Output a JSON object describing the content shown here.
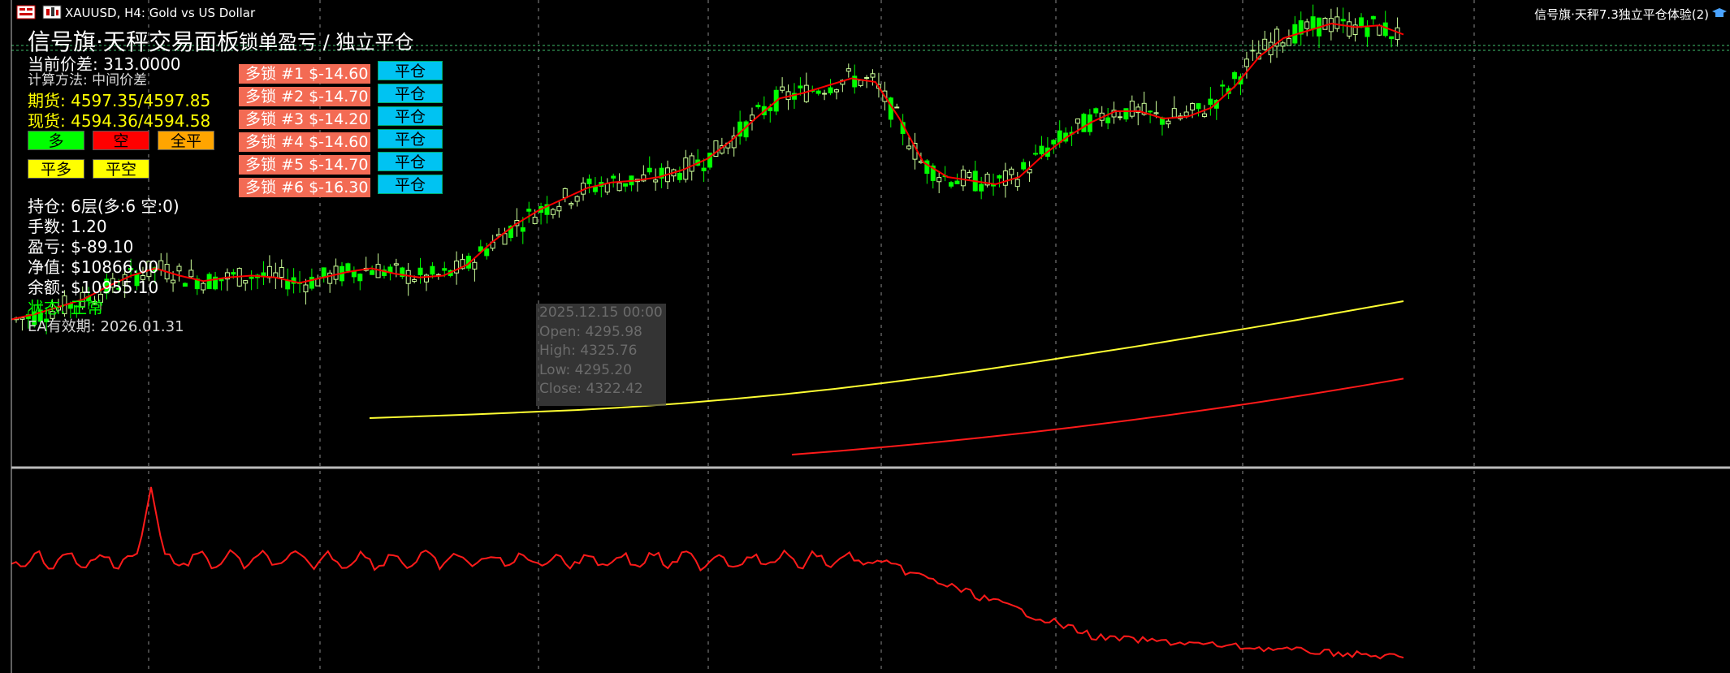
{
  "window": {
    "symbol_title": "XAUUSD, H4: Gold vs US Dollar",
    "ea_title": "信号旗·天秤7.3独立平仓体验(2)"
  },
  "panel": {
    "title": "信号旗·天秤交易面板",
    "spread_label": "当前价差: 313.0000",
    "calc_method": "计算方法: 中间价差",
    "futures": "期货: 4597.35/4597.85",
    "spot": "现货: 4594.36/4594.58",
    "buttons": {
      "buy": "多",
      "sell": "空",
      "close_all": "全平",
      "close_buy": "平多",
      "close_sell": "平空"
    },
    "positions": "持仓: 6层(多:6 空:0)",
    "lots": "手数: 1.20",
    "pnl": "盈亏: $-89.10",
    "equity": "净值: $10866.00",
    "balance": "余额: $10955.10",
    "status": "状态: 正常",
    "expiry": "EA有效期: 2026.01.31"
  },
  "locks": {
    "title": "锁单盈亏 / 独立平仓",
    "close_label": "平仓",
    "rows": [
      {
        "label": "多锁 #1  $-14.60"
      },
      {
        "label": "多锁 #2  $-14.70"
      },
      {
        "label": "多锁 #3  $-14.20"
      },
      {
        "label": "多锁 #4  $-14.60"
      },
      {
        "label": "多锁 #5  $-14.70"
      },
      {
        "label": "多锁 #6  $-16.30"
      }
    ]
  },
  "tooltip": {
    "date": "2025.12.15 00:00",
    "open": "Open: 4295.98",
    "high": "High: 4325.76",
    "low": "Low: 4295.20",
    "close": "Close: 4322.42"
  },
  "colors": {
    "background": "#000000",
    "bull_candle": "#ccff99",
    "bear_candle": "#00ff00",
    "ma_fast": "#ff0000",
    "ma_slow_yellow": "#ffff33",
    "ma_slow_red": "#ff1a1a",
    "grid": "#ffffff"
  },
  "chart_data": {
    "type": "line",
    "series": [
      {
        "values": [
          3870,
          3885,
          3905,
          3925,
          3960,
          3990,
          4010,
          3990,
          3975,
          3985,
          3990,
          3985,
          3970,
          3985,
          4000,
          4010,
          3995,
          3985,
          3990,
          4020,
          4080,
          4130,
          4170,
          4200,
          4230,
          4245,
          4250,
          4260,
          4280,
          4310,
          4360,
          4420,
          4475,
          4490,
          4510,
          4530,
          4520,
          4420,
          4300,
          4260,
          4250,
          4240,
          4260,
          4320,
          4370,
          4410,
          4440,
          4440,
          4420,
          4425,
          4450,
          4510,
          4590,
          4640,
          4660,
          4680,
          4670,
          4675,
          4650
        ]
      },
      {
        "values": [
          3600,
          3605,
          3610,
          3616,
          3622,
          3630,
          3640,
          3652,
          3665,
          3680,
          3697,
          3715,
          3735,
          3756,
          3778,
          3800,
          3823,
          3846,
          3870,
          3895,
          3920
        ]
      },
      {
        "values": [
          3500,
          3510,
          3521,
          3533,
          3546,
          3560,
          3575,
          3591,
          3608,
          3626,
          3645,
          3665,
          3686,
          3708
        ]
      }
    ]
  }
}
